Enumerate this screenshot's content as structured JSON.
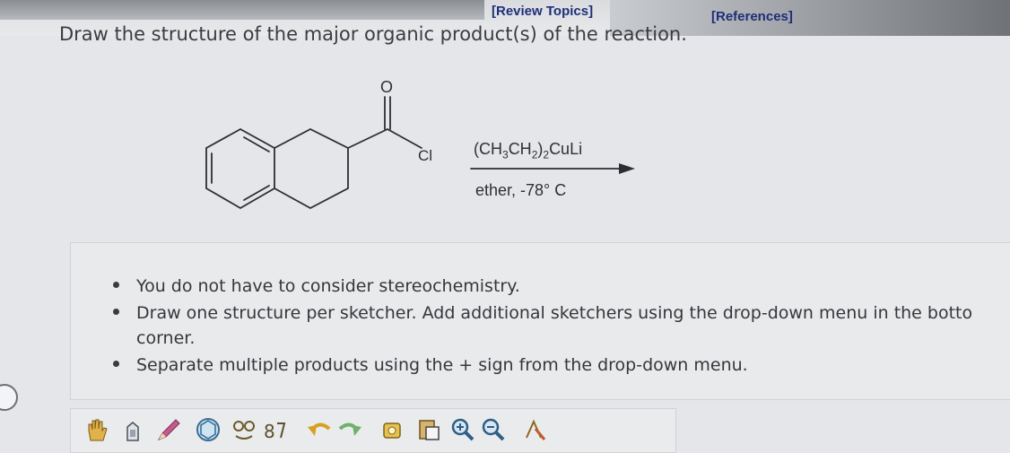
{
  "header": {
    "review_topics": "[Review Topics]",
    "references": "[References]"
  },
  "question": {
    "prompt": "Draw the structure of the major organic product(s) of the reaction."
  },
  "reaction": {
    "carbonyl_atom": "O",
    "chloride_atom": "Cl",
    "reagent_above": {
      "p1": "(CH",
      "s1": "3",
      "p2": "CH",
      "s2": "2",
      "p3": ")",
      "s3": "2",
      "p4": "CuLi"
    },
    "reagent_below": "ether, -78° C"
  },
  "instructions": {
    "items": [
      "You do not have to consider stereochemistry.",
      "Draw one structure per sketcher. Add additional sketchers using the drop-down menu in the botto",
      "corner.",
      "Separate multiple products using the + sign from the drop-down menu."
    ]
  },
  "toolbar": {
    "tools": [
      "hand-pan-icon",
      "erase-icon",
      "pencil-bond-icon",
      "ring-template-icon",
      "atom-map-icon",
      "chain-icon",
      "undo-icon",
      "redo-icon",
      "copy-icon",
      "paste-icon",
      "zoom-in-icon",
      "zoom-out-icon",
      "atom-label-icon"
    ]
  }
}
